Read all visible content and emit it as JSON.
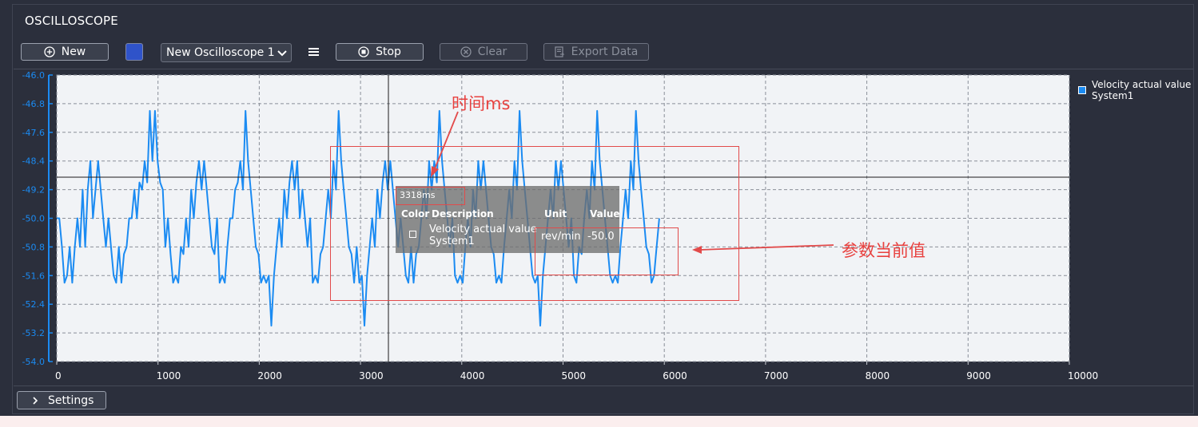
{
  "window": {
    "title": "OSCILLOSCOPE"
  },
  "toolbar": {
    "new_label": "New",
    "selected_scope": "New Oscilloscope 1",
    "stop_label": "Stop",
    "clear_label": "Clear",
    "export_label": "Export Data",
    "swatch_color": "#2f53c9"
  },
  "chart_data": {
    "type": "line",
    "xlim": [
      0,
      10000
    ],
    "ylim": [
      -54.0,
      -46.0
    ],
    "x_ticks": [
      0,
      1000,
      2000,
      3000,
      4000,
      5000,
      6000,
      7000,
      8000,
      9000,
      10000
    ],
    "y_ticks": [
      "-46.0",
      "-46.8",
      "-47.6",
      "-48.4",
      "-49.2",
      "-50.0",
      "-50.8",
      "-51.6",
      "-52.4",
      "-53.2",
      "-54.0"
    ],
    "grid": true,
    "legend_position": "top-right",
    "series": [
      {
        "name": "Velocity actual value System1",
        "color": "#1b8bf2",
        "samples": [
          -50.0,
          -50.0,
          -50.8,
          -51.8,
          -51.6,
          -50.8,
          -51.8,
          -50.8,
          -50.0,
          -50.8,
          -49.2,
          -50.8,
          -49.2,
          -48.4,
          -50.0,
          -49.2,
          -48.4,
          -49.2,
          -50.0,
          -50.8,
          -50.0,
          -50.8,
          -51.6,
          -51.8,
          -50.8,
          -51.8,
          -51.0,
          -50.8,
          -50.0,
          -50.0,
          -49.2,
          -50.0,
          -49.0,
          -49.2,
          -48.4,
          -49.0,
          -47.0,
          -48.4,
          -47.0,
          -48.4,
          -49.0,
          -49.2,
          -50.8,
          -50.0,
          -51.0,
          -51.8,
          -51.6,
          -51.8,
          -50.8,
          -51.0,
          -50.0,
          -50.8,
          -49.2,
          -50.0,
          -49.0,
          -48.4,
          -49.2,
          -48.4,
          -49.2,
          -50.0,
          -50.8,
          -51.0,
          -50.0,
          -51.8,
          -51.6,
          -51.8,
          -50.8,
          -50.0,
          -50.0,
          -49.2,
          -49.0,
          -48.4,
          -49.2,
          -47.0,
          -48.4,
          -49.2,
          -50.0,
          -50.8,
          -51.0,
          -51.8,
          -51.6,
          -51.8,
          -51.6,
          -53.0,
          -51.6,
          -50.8,
          -50.0,
          -50.8,
          -49.2,
          -50.0,
          -49.0,
          -48.4,
          -49.2,
          -48.4,
          -50.0,
          -49.2,
          -50.0,
          -50.8,
          -50.0,
          -51.8,
          -51.6,
          -51.8,
          -51.0,
          -50.8,
          -50.0,
          -49.2,
          -50.0,
          -48.4,
          -49.2,
          -47.0,
          -48.4,
          -49.2,
          -50.0,
          -50.8,
          -51.0,
          -51.8,
          -50.8,
          -51.8,
          -51.6,
          -53.0,
          -51.6,
          -50.8,
          -50.0,
          -50.8,
          -49.2,
          -50.0,
          -49.0,
          -48.4,
          -49.2,
          -48.4,
          -49.2,
          -50.0,
          -50.8,
          -50.0,
          -50.8,
          -51.6,
          -51.8,
          -50.8,
          -51.8,
          -51.0,
          -50.8,
          -50.0,
          -49.2,
          -50.0,
          -48.4,
          -49.2,
          -48.4,
          -49.0,
          -47.0,
          -48.4,
          -49.2,
          -50.0,
          -50.8,
          -50.0,
          -51.6,
          -51.8,
          -51.6,
          -51.8,
          -50.8,
          -50.0,
          -50.8,
          -49.2,
          -50.0,
          -48.4,
          -49.2,
          -48.4,
          -49.2,
          -50.0,
          -50.8,
          -51.0,
          -51.8,
          -51.6,
          -51.8,
          -50.8,
          -50.0,
          -49.2,
          -50.0,
          -48.4,
          -49.2,
          -47.0,
          -48.4,
          -49.2,
          -50.0,
          -50.8,
          -51.6,
          -51.8,
          -51.6,
          -53.0,
          -51.6,
          -50.8,
          -50.0,
          -49.2,
          -50.0,
          -48.4,
          -49.2,
          -48.4,
          -49.2,
          -50.0,
          -50.8,
          -50.0,
          -51.6,
          -51.8,
          -50.8,
          -51.0,
          -50.0,
          -49.2,
          -50.0,
          -48.4,
          -49.2,
          -47.0,
          -48.4,
          -49.2,
          -50.0,
          -50.8,
          -51.6,
          -51.8,
          -51.6,
          -51.8,
          -50.8,
          -50.0,
          -49.2,
          -50.0,
          -48.4,
          -49.2,
          -47.0,
          -48.4,
          -49.2,
          -50.0,
          -50.8,
          -51.0,
          -51.8,
          -51.6,
          -50.8,
          -50.0
        ]
      }
    ]
  },
  "tooltip": {
    "time": "3318ms",
    "headers": {
      "color": "Color",
      "description": "Description",
      "unit": "Unit",
      "value": "Value"
    },
    "row": {
      "description": "Velocity actual value System1",
      "unit": "rev/min",
      "value": "-50.0"
    }
  },
  "annotations": {
    "time_label": "时间ms",
    "value_label": "参数当前值",
    "color": "#e24a4a"
  },
  "settings": {
    "label": "Settings"
  }
}
